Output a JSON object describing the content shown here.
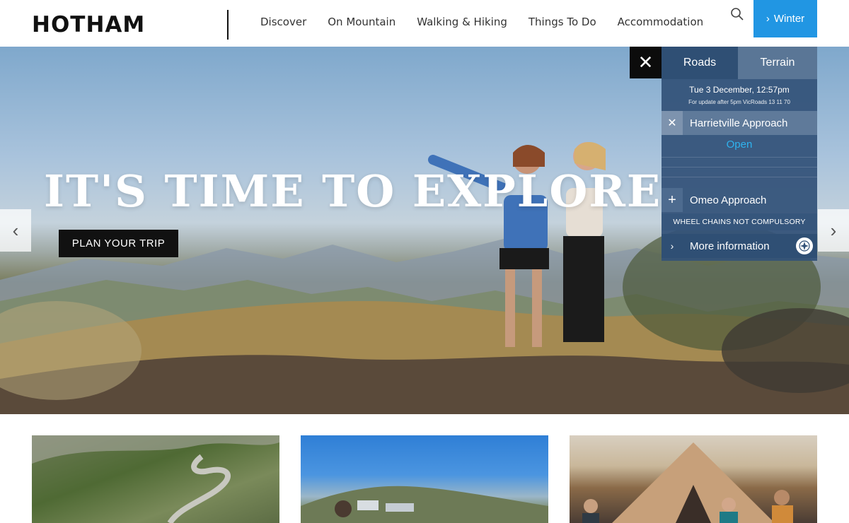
{
  "header": {
    "logo": "HOTHAM",
    "nav": [
      "Discover",
      "On Mountain",
      "Walking & Hiking",
      "Things To Do",
      "Accommodation"
    ],
    "search_icon": "search-icon",
    "season_button": "Winter"
  },
  "hero": {
    "title": "IT'S TIME TO EXPLORE",
    "cta": "PLAN YOUR TRIP",
    "prev_icon": "chevron-left-icon",
    "next_icon": "chevron-right-icon"
  },
  "roads_panel": {
    "tabs": [
      "Roads",
      "Terrain"
    ],
    "active_tab": "Roads",
    "date": "Tue 3 December, 12:57pm",
    "update_note": "For update after 5pm VicRoads 13 11 70",
    "roads": [
      {
        "name": "Harrietville Approach",
        "expanded": true,
        "status": "Open"
      },
      {
        "name": "Omeo Approach",
        "expanded": false
      }
    ],
    "chains_notice": "WHEEL CHAINS NOT COMPULSORY",
    "more_info": "More information"
  },
  "colors": {
    "accent": "#2196e3",
    "panel": "#335278",
    "open_status": "#2fb3ef"
  }
}
